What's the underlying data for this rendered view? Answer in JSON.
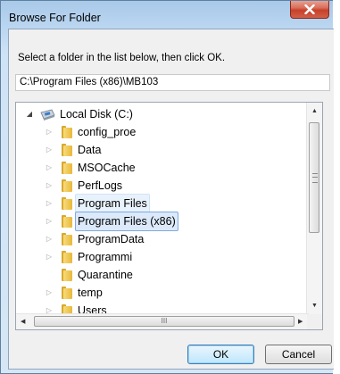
{
  "dialog": {
    "title": "Browse For Folder",
    "instruction": "Select a folder in the list below, then click OK.",
    "path": "C:\\Program Files (x86)\\MB103"
  },
  "tree": {
    "root": "Local Disk (C:)",
    "items": [
      {
        "label": "config_proe"
      },
      {
        "label": "Data"
      },
      {
        "label": "MSOCache"
      },
      {
        "label": "PerfLogs"
      },
      {
        "label": "Program Files"
      },
      {
        "label": "Program Files (x86)"
      },
      {
        "label": "ProgramData"
      },
      {
        "label": "Programmi"
      },
      {
        "label": "Quarantine"
      },
      {
        "label": "temp"
      },
      {
        "label": "Users"
      }
    ],
    "hscroll_grip": "III"
  },
  "buttons": {
    "ok": "OK",
    "cancel": "Cancel"
  },
  "icons": {
    "close": "close-icon",
    "drive": "drive-icon",
    "folder": "folder-icon"
  }
}
